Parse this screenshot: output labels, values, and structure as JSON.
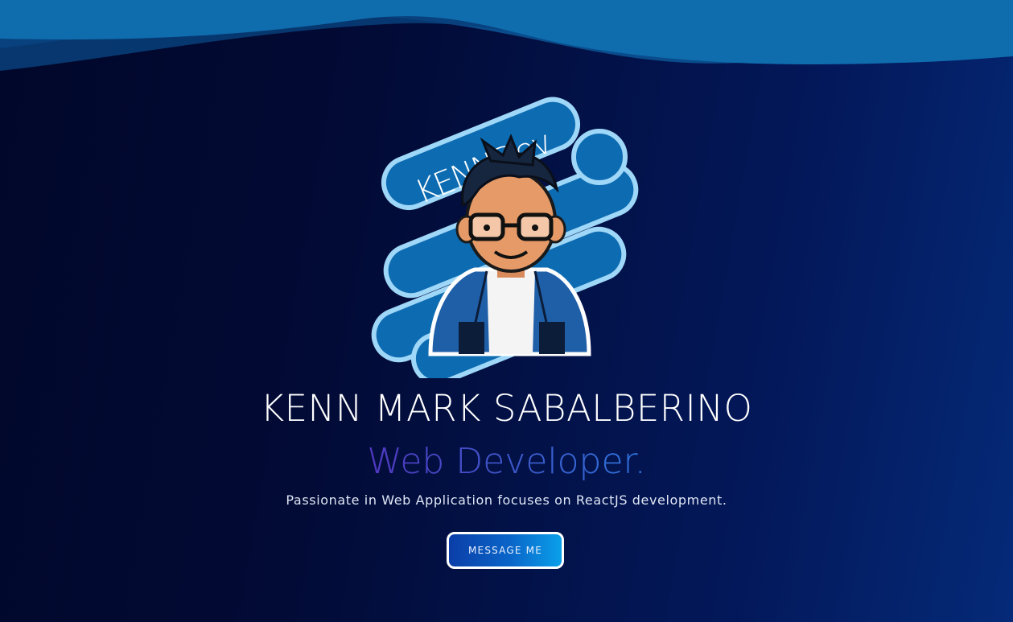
{
  "hero": {
    "logo_text": "KENNDev",
    "name": "KENN MARK SABALBERINO",
    "role": "Web Developer.",
    "tagline": "Passionate in Web Application focuses on ReactJS development.",
    "cta_label": "MESSAGE ME"
  },
  "colors": {
    "background_dark": "#01072a",
    "background_light": "#052a78",
    "wave_front": "#0f6cad",
    "wave_back": "#0a4f8f",
    "accent_purple": "#4a2fb4",
    "accent_blue": "#2f6fd8",
    "button_start": "#0b3ea8",
    "button_end": "#0aa0ea"
  },
  "icons": {
    "logo": "kenndev-avatar-logo"
  }
}
